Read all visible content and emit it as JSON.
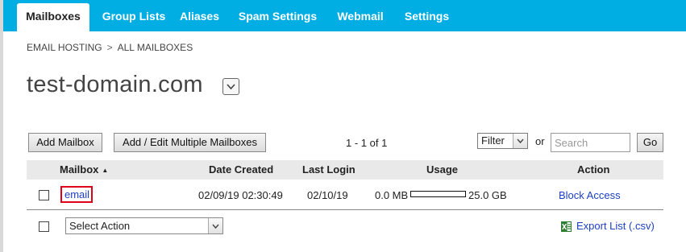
{
  "nav": {
    "tabs": [
      {
        "label": "Mailboxes",
        "active": true
      },
      {
        "label": "Group Lists"
      },
      {
        "label": "Aliases"
      },
      {
        "label": "Spam Settings"
      },
      {
        "label": "Webmail"
      },
      {
        "label": "Settings"
      }
    ]
  },
  "breadcrumb": {
    "items": [
      "EMAIL HOSTING",
      "ALL MAILBOXES"
    ],
    "separator": ">"
  },
  "domain": {
    "name": "test-domain.com",
    "dropdown_icon": "chevron-down-icon"
  },
  "toolbar": {
    "add_mailbox_label": "Add Mailbox",
    "add_multiple_label": "Add / Edit Multiple Mailboxes",
    "pagination": "1 - 1 of 1",
    "filter_value": "Filter",
    "or_label": "or",
    "search_placeholder": "Search",
    "go_label": "Go"
  },
  "table": {
    "headers": {
      "mailbox": "Mailbox",
      "date_created": "Date Created",
      "last_login": "Last Login",
      "usage": "Usage",
      "action": "Action"
    },
    "sort_indicator": "▲",
    "rows": [
      {
        "mailbox": "email",
        "date_created": "02/09/19 02:30:49",
        "last_login": "02/10/19",
        "usage_used": "0.0 MB",
        "usage_total": "25.0 GB",
        "usage_fraction": 0.0,
        "action": "Block Access"
      }
    ]
  },
  "footer": {
    "select_action_label": "Select Action",
    "export_label": "Export List (.csv)",
    "export_icon": "excel-icon"
  },
  "colors": {
    "nav_bg": "#00aee3",
    "link": "#1d3ec4",
    "highlight_border": "#e0001a",
    "header_row_bg": "#e9e9e9"
  }
}
